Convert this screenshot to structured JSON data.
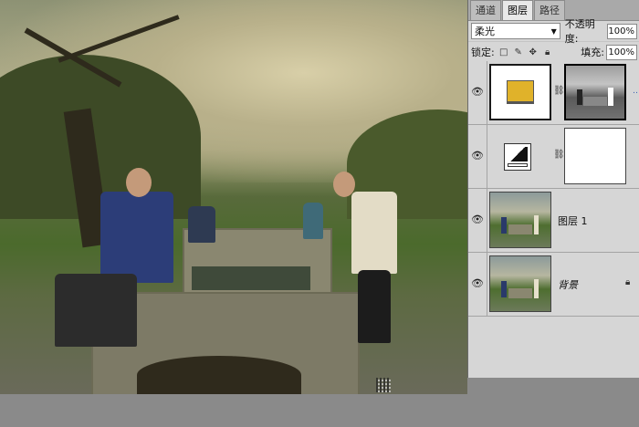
{
  "panel": {
    "tabs": [
      {
        "label": "通道",
        "active": false
      },
      {
        "label": "图层",
        "active": true
      },
      {
        "label": "路径",
        "active": false
      }
    ],
    "blend_mode": "柔光",
    "opacity_label": "不透明度:",
    "opacity_value": "100%",
    "lock_label": "锁定:",
    "fill_label": "填充:",
    "fill_value": "100%",
    "layers": [
      {
        "name": "",
        "type": "color-fill-with-mask",
        "fill_color": "#e0b22a",
        "selected": true
      },
      {
        "name": "",
        "type": "levels-adjustment-with-mask",
        "selected": false
      },
      {
        "name": "图层 1",
        "type": "pixel",
        "selected": false
      },
      {
        "name": "背景",
        "type": "background",
        "locked": true,
        "selected": false
      }
    ]
  },
  "colors": {
    "fill_swatch": "#e0b22a",
    "panel_bg": "#d6d6d6",
    "select_border": "#3a5fb0"
  }
}
